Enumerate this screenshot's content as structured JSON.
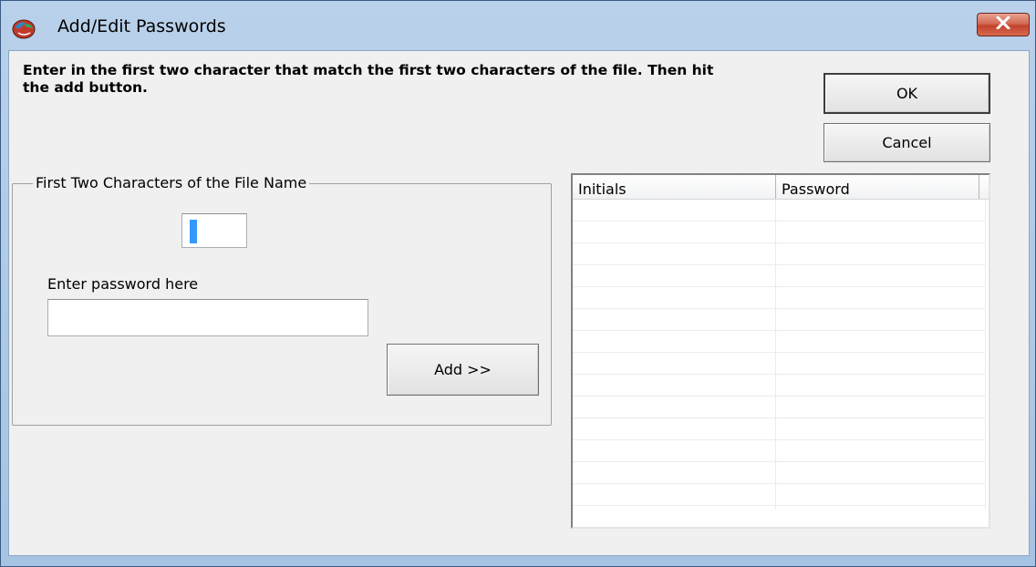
{
  "window": {
    "title": "Add/Edit Passwords",
    "close_glyph": "✕"
  },
  "instructions": "Enter in the first two character that match the first two characters of the file. Then hit the add button.",
  "buttons": {
    "ok_label": "OK",
    "cancel_label": "Cancel",
    "add_label": "Add >>"
  },
  "group": {
    "legend": "First Two Characters of the File Name",
    "initials_value": "",
    "password_label": "Enter password here",
    "password_value": ""
  },
  "list": {
    "columns": [
      "Initials",
      "Password"
    ],
    "rows": []
  },
  "icons": {
    "app": "globe-icon",
    "close": "close-icon"
  },
  "colors": {
    "close_button": "#c3432c",
    "selection": "#3399ff",
    "dialog_background": "#f0f0f0"
  }
}
